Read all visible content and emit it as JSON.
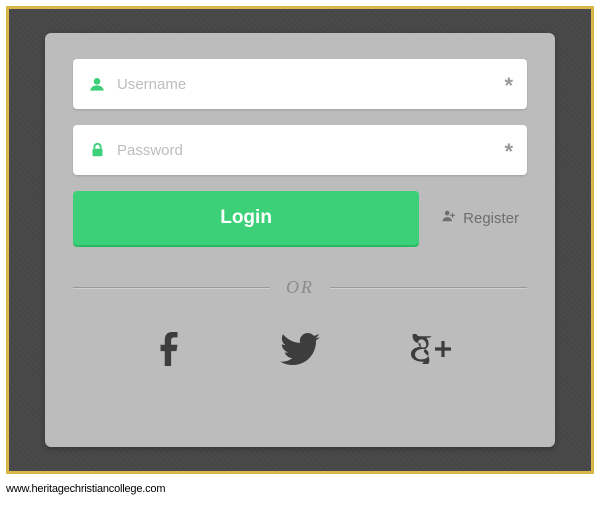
{
  "fields": {
    "username": {
      "placeholder": "Username",
      "value": "",
      "required_marker": "*"
    },
    "password": {
      "placeholder": "Password",
      "value": "",
      "required_marker": "*"
    }
  },
  "actions": {
    "login_label": "Login",
    "register_label": "Register"
  },
  "divider": {
    "label": "OR"
  },
  "social": [
    {
      "name": "facebook"
    },
    {
      "name": "twitter"
    },
    {
      "name": "google-plus"
    }
  ],
  "attribution": "www.heritagechristiancollege.com",
  "colors": {
    "accent": "#3cd078"
  }
}
